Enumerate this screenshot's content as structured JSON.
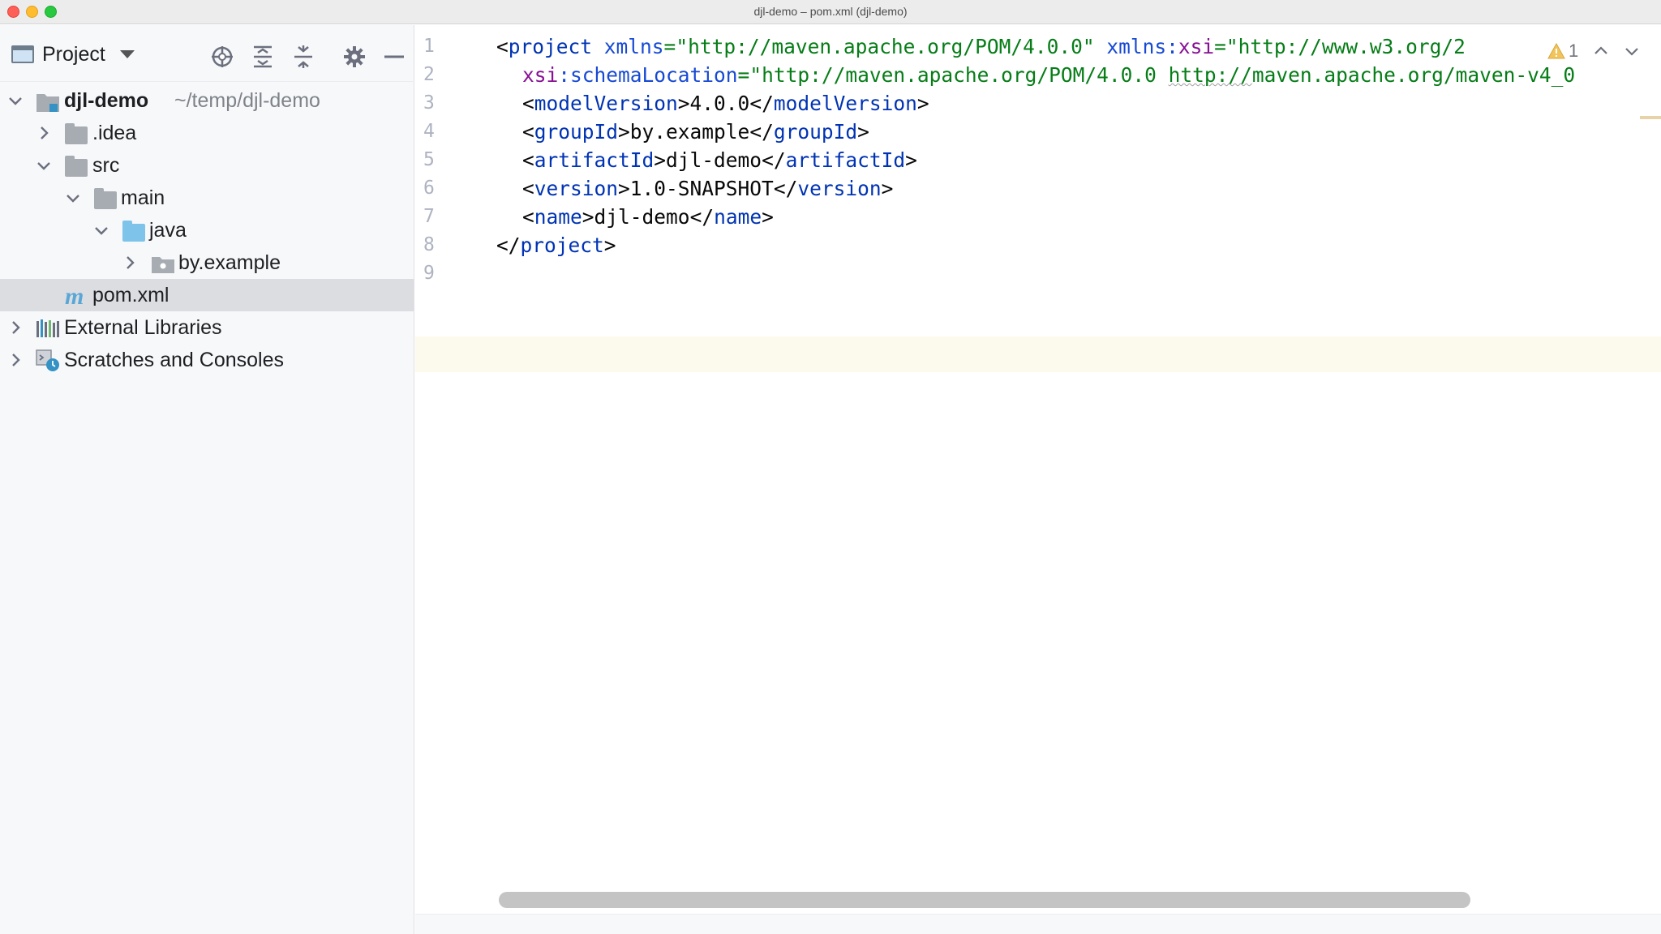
{
  "window": {
    "title": "djl-demo – pom.xml (djl-demo)"
  },
  "project_pane": {
    "title": "Project",
    "tools": [
      "locate-icon",
      "expand-all-icon",
      "collapse-all-icon",
      "gear-icon",
      "minimize-icon"
    ],
    "tree": [
      {
        "label": "djl-demo",
        "path": "~/temp/djl-demo"
      },
      {
        "label": ".idea"
      },
      {
        "label": "src"
      },
      {
        "label": "main"
      },
      {
        "label": "java"
      },
      {
        "label": "by.example"
      },
      {
        "label": "pom.xml"
      },
      {
        "label": "External Libraries"
      },
      {
        "label": "Scratches and Consoles"
      }
    ]
  },
  "editor": {
    "line_numbers": [
      "1",
      "2",
      "3",
      "4",
      "5",
      "6",
      "7",
      "8",
      "9"
    ],
    "lines": {
      "l1": {
        "open": "<",
        "tag": "project",
        "a1_name": " xmlns",
        "a1_eq": "=",
        "a1_val": "\"http://maven.apache.org/POM/4.0.0\"",
        "a2_ns": " xmlns",
        "a2_colon": ":",
        "a2_name": "xsi",
        "a2_eq": "=",
        "a2_val": "\"http://www.w3.org/2"
      },
      "l2": {
        "ns": "xsi",
        "colon": ":",
        "name": "schemaLocation",
        "eq": "=",
        "val_a": "\"http://maven.apache.org/POM/4.0.0 ",
        "val_b": "http://",
        "val_c": "maven.apache.org/maven-v4_0"
      },
      "l3": {
        "tag": "modelVersion",
        "text": "4.0.0"
      },
      "l4": {
        "tag": "groupId",
        "text": "by.example"
      },
      "l5": {
        "tag": "artifactId",
        "text": "djl-demo"
      },
      "l6": {
        "tag": "version",
        "text": "1.0-SNAPSHOT"
      },
      "l7": {
        "tag": "name",
        "text": "djl-demo"
      },
      "l8": {
        "tag": "project"
      }
    },
    "inspections": {
      "warnings": "1"
    }
  }
}
